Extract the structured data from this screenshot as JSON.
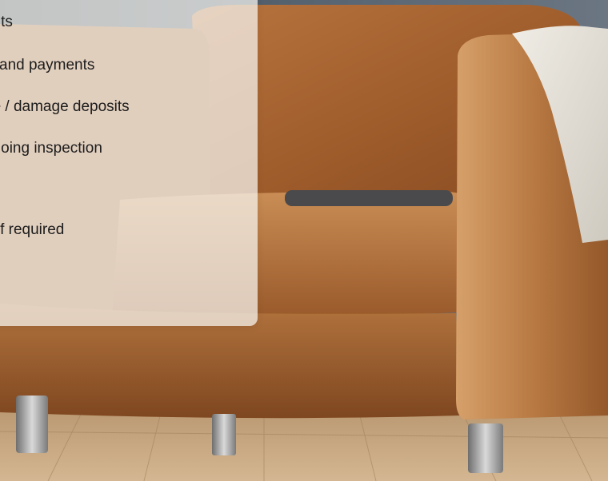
{
  "features": {
    "items": [
      {
        "label": "ents"
      },
      {
        "label": "ls and payments"
      },
      {
        "label": "ge / damage deposits"
      },
      {
        "label": "ngoing inspection"
      },
      {
        "label": "n if required"
      }
    ]
  },
  "colors": {
    "wall": "#4f5a64",
    "leather": "#a8612f",
    "leather_light": "#c98a52",
    "floor": "#c4a47e",
    "card_bg": "#f8f6f2",
    "text": "#1c1c1c"
  },
  "icons": {
    "furniture": "armchair-image"
  }
}
